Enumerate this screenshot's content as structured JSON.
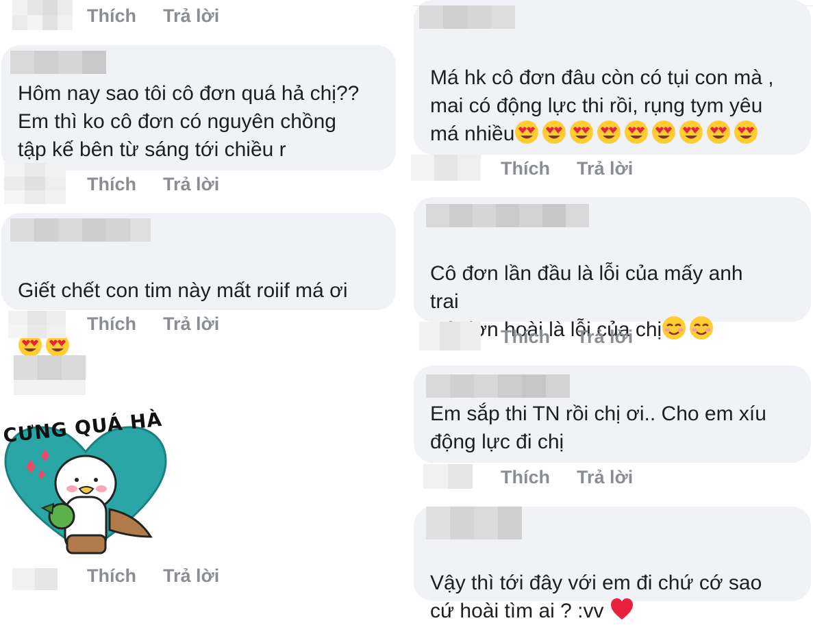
{
  "actions": {
    "like": "Thích",
    "reply": "Trả lời"
  },
  "left_comments": [
    {
      "text": "Hôm nay sao tôi cô đơn quá hả chị??\nEm thì ko cô đơn có nguyên chồng\ntập kế bên từ sáng tới chiều r"
    },
    {
      "text": "Giết chết con tim này mất roiif má ơi",
      "emoji_after": [
        "heart-eyes",
        "heart-eyes"
      ]
    }
  ],
  "sticker": {
    "caption": "CƯNG QUÁ HÀ",
    "colors": {
      "heart": "#2aa6a6",
      "outline": "#222222",
      "pink": "#e94b6a"
    }
  },
  "right_comments": [
    {
      "text": "Má hk cô đơn đâu còn có tụi con mà ,\nmai có động lực thi rồi, rụng tym yêu\nmá nhiều",
      "emoji_count": 9
    },
    {
      "text": "Cô đơn lần đầu là lỗi của mấy anh\ntrai\nCô đơn hoài là lỗi của chị",
      "emoji_after": [
        "smiling-face",
        "smiling-face"
      ]
    },
    {
      "text": "Em sắp thi TN rồi chị ơi.. Cho em xíu\nđộng lực đi chị"
    },
    {
      "text": "Vậy thì tới đây với em đi chứ cớ sao\ncứ hoài tìm ai ? :vv",
      "emoji_after": [
        "red-heart"
      ]
    }
  ],
  "colors": {
    "bubble": "#f0f2f5",
    "action_text": "#8a8d91",
    "text": "#1c1e21"
  }
}
